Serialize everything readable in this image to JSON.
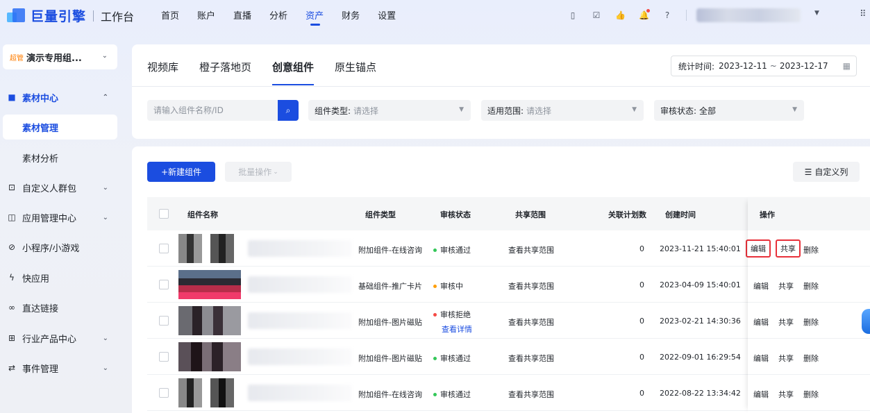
{
  "header": {
    "logo_text": "巨量引擎",
    "workspace": "工作台",
    "nav": [
      "首页",
      "账户",
      "直播",
      "分析",
      "资产",
      "财务",
      "设置"
    ],
    "nav_active_index": 4,
    "icons": [
      "phone-icon",
      "clipboard-icon",
      "thumbs-up-icon",
      "notification-bell-icon",
      "help-icon",
      "apps-grid-icon"
    ]
  },
  "sidebar": {
    "org_tag": "超管",
    "org_name": "演示专用组...",
    "items": [
      {
        "label": "素材中心",
        "icon": "material-icon",
        "expanded": true
      },
      {
        "label": "素材管理"
      },
      {
        "label": "素材分析"
      },
      {
        "label": "自定义人群包",
        "icon": "audience-icon"
      },
      {
        "label": "应用管理中心",
        "icon": "app-icon"
      },
      {
        "label": "小程序/小游戏",
        "icon": "miniapp-icon"
      },
      {
        "label": "快应用",
        "icon": "lightning-icon"
      },
      {
        "label": "直达链接",
        "icon": "link-icon"
      },
      {
        "label": "行业产品中心",
        "icon": "grid-icon"
      },
      {
        "label": "事件管理",
        "icon": "event-icon"
      }
    ]
  },
  "tabs": [
    "视频库",
    "橙子落地页",
    "创意组件",
    "原生锚点"
  ],
  "tabs_active_index": 2,
  "date_range": {
    "label": "统计时间:",
    "start": "2023-12-11",
    "sep": "~",
    "end": "2023-12-17"
  },
  "filters": {
    "search_placeholder": "请输入组件名称/ID",
    "type_label": "组件类型:",
    "type_placeholder": "请选择",
    "scope_label": "适用范围:",
    "scope_placeholder": "请选择",
    "review_label": "审核状态:",
    "review_value": "全部"
  },
  "toolbar": {
    "new_label": "+新建组件",
    "batch_label": "批量操作",
    "custom_cols_label": "自定义列"
  },
  "table": {
    "columns": [
      "组件名称",
      "组件类型",
      "审核状态",
      "共享范围",
      "关联计划数",
      "创建时间",
      "操作"
    ],
    "rows": [
      {
        "type": "附加组件-在线咨询",
        "status": "审核通过",
        "status_color": "#34c759",
        "scope": "查看共享范围",
        "plans": "0",
        "created": "2023-11-21 15:40:01"
      },
      {
        "type": "基础组件-推广卡片",
        "status": "审核中",
        "status_color": "#ff9f0a",
        "scope": "查看共享范围",
        "plans": "0",
        "created": "2023-04-09 15:40:01"
      },
      {
        "type": "附加组件-图片磁贴",
        "status": "审核拒绝",
        "status_color": "#f54a45",
        "detail": "查看详情",
        "scope": "查看共享范围",
        "plans": "0",
        "created": "2023-02-21 14:30:36"
      },
      {
        "type": "附加组件-图片磁贴",
        "status": "审核通过",
        "status_color": "#34c759",
        "scope": "查看共享范围",
        "plans": "0",
        "created": "2022-09-01 16:29:54"
      },
      {
        "type": "附加组件-在线咨询",
        "status": "审核通过",
        "status_color": "#34c759",
        "scope": "查看共享范围",
        "plans": "0",
        "created": "2022-08-22 13:34:42"
      }
    ],
    "actions": [
      "编辑",
      "共享",
      "删除"
    ]
  }
}
